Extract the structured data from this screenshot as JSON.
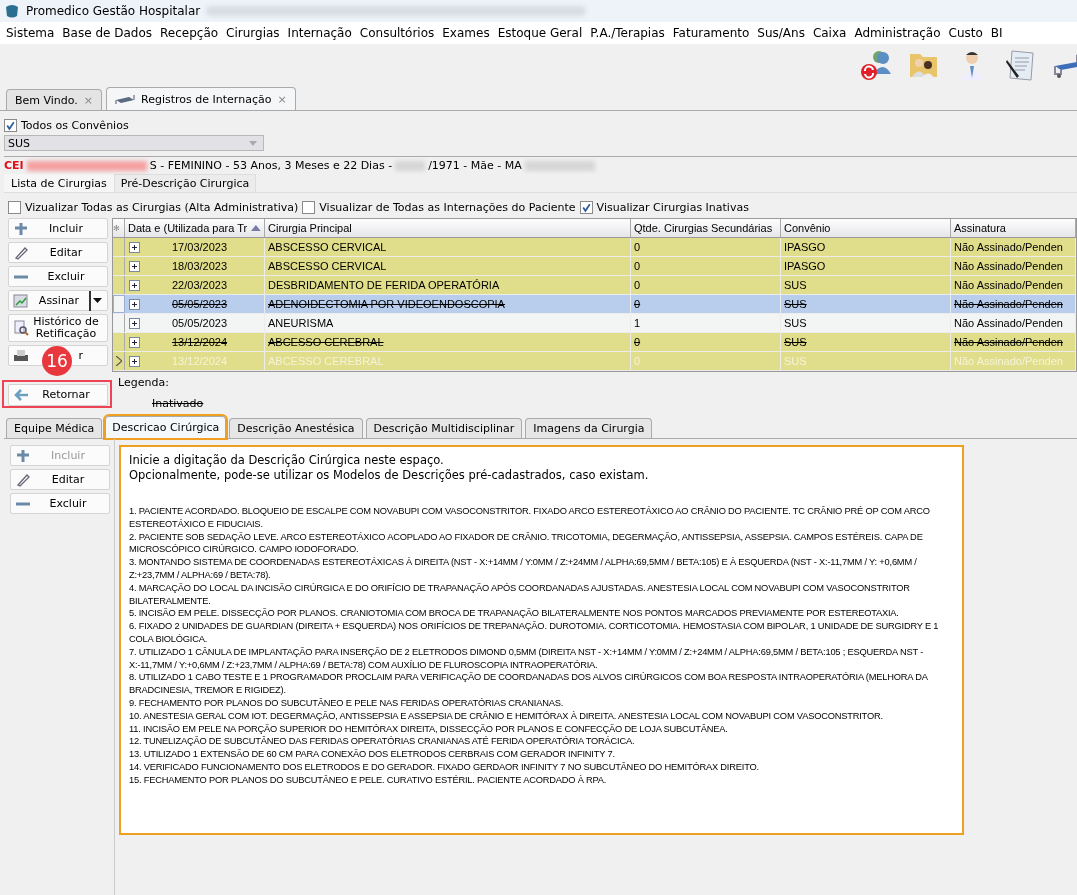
{
  "window": {
    "title": "Promedico Gestão Hospitalar"
  },
  "menu": [
    "Sistema",
    "Base de Dados",
    "Recepção",
    "Cirurgias",
    "Internação",
    "Consultórios",
    "Exames",
    "Estoque Geral",
    "P.A./Terapias",
    "Faturamento",
    "Sus/Ans",
    "Caixa",
    "Administração",
    "Custo",
    "BI"
  ],
  "toolbar": [
    {
      "kind": "users-refresh"
    },
    {
      "kind": "folder-people"
    },
    {
      "kind": "doctor"
    },
    {
      "kind": "document-pen"
    },
    {
      "kind": "bed"
    }
  ],
  "doc_tabs": [
    {
      "label": "Bem Vindo.",
      "close": "×",
      "selected": false,
      "icon": false
    },
    {
      "label": "Registros de Internação",
      "close": "×",
      "selected": true,
      "icon": true
    }
  ],
  "all_insurers": {
    "label": "Todos os Convênios",
    "checked": true
  },
  "insurer_select": {
    "value": "SUS"
  },
  "patient": {
    "name_start": "CEI",
    "info": "S - FEMININO - 53 Anos, 3 Meses e 22 Dias -",
    "birth": "/1971 - Mãe - MA"
  },
  "sub_tabs": [
    {
      "label": "Lista de Cirurgias",
      "selected": true
    },
    {
      "label": "Pré-Descrição Cirurgica",
      "selected": false
    }
  ],
  "filters": [
    {
      "label": "Vizualizar Todas as Cirurgias (Alta Administrativa)",
      "checked": false
    },
    {
      "label": "Visualizar de Todas as Internações do Paciente",
      "checked": false
    },
    {
      "label": "Visualizar Cirurgias Inativas",
      "checked": true
    }
  ],
  "actions": [
    {
      "label": "Incluir",
      "kind": "plus"
    },
    {
      "label": "Editar",
      "kind": "pencil"
    },
    {
      "label": "Excluir",
      "kind": "minus"
    },
    {
      "label": "Assinar",
      "kind": "sign",
      "dropdown": true
    },
    {
      "label": "Histórico de Retificação",
      "kind": "search"
    },
    {
      "label": "r",
      "kind": "printer"
    }
  ],
  "table": {
    "corner": "✻",
    "columns": [
      "Data e (Utilizada para Tr",
      "Cirurgia Principal",
      "Qtde. Cirurgias Secundárias",
      "Convênio",
      "Assinatura"
    ],
    "rows": [
      {
        "cells": [
          "17/03/2023",
          "ABSCESSO CERVICAL",
          "0",
          "IPASGO",
          "Não Assinado/Penden"
        ],
        "color": "#e1de8b",
        "selected": false,
        "inactive": false,
        "faded": false,
        "current": false
      },
      {
        "cells": [
          "18/03/2023",
          "ABSCESSO CERVICAL",
          "0",
          "IPASGO",
          "Não Assinado/Penden"
        ],
        "color": "#e1de8b",
        "selected": false,
        "inactive": false,
        "faded": false,
        "current": false
      },
      {
        "cells": [
          "22/03/2023",
          "DESBRIDAMENTO DE FERIDA OPERATÓRIA",
          "0",
          "SUS",
          "Não Assinado/Penden"
        ],
        "color": "#e1de8b",
        "selected": false,
        "inactive": false,
        "faded": false,
        "current": false
      },
      {
        "cells": [
          "05/05/2023",
          "ADENOIDECTOMIA POR VIDEOENDOSCOPIA",
          "0",
          "SUS",
          "Não Assinado/Penden"
        ],
        "color": "#f3f5f5",
        "selected": true,
        "inactive": true,
        "faded": false,
        "current": false
      },
      {
        "cells": [
          "05/05/2023",
          "ANEURISMA",
          "1",
          "SUS",
          "Não Assinado/Penden"
        ],
        "color": "#f3f5f5",
        "selected": false,
        "inactive": false,
        "faded": false,
        "current": false
      },
      {
        "cells": [
          "13/12/2024",
          "ABCESSO CEREBRAL",
          "0",
          "SUS",
          "Não Assinado/Penden"
        ],
        "color": "#e1de8b",
        "selected": false,
        "inactive": true,
        "faded": false,
        "current": false
      },
      {
        "cells": [
          "13/12/2024",
          "ABCESSO CEREBRAL",
          "0",
          "SUS",
          "Não Assinado/Penden"
        ],
        "color": "#e1de8b",
        "selected": false,
        "inactive": false,
        "faded": true,
        "current": true
      }
    ]
  },
  "legend": {
    "title": "Legenda:",
    "item": "Inativado"
  },
  "return_button": {
    "label": "Retornar"
  },
  "step_badge": "16",
  "detail_tabs": [
    {
      "label": "Equipe Médica",
      "selected": false
    },
    {
      "label": "Descricao Cirúrgica",
      "selected": true
    },
    {
      "label": "Descrição Anestésica",
      "selected": false
    },
    {
      "label": "Descrição Multidisciplinar",
      "selected": false
    },
    {
      "label": "Imagens da Cirurgia",
      "selected": false
    }
  ],
  "detail_actions": [
    {
      "label": "Incluir",
      "kind": "plus",
      "disabled": true
    },
    {
      "label": "Editar",
      "kind": "pencil",
      "disabled": false
    },
    {
      "label": "Excluir",
      "kind": "minus",
      "disabled": false
    }
  ],
  "description": {
    "intro": [
      "Inicie a digitação da Descrição Cirúrgica neste espaço.",
      "Opcionalmente, pode-se utilizar os Modelos de Descrições pré-cadastrados, caso existam."
    ],
    "steps": [
      "1. PACIENTE ACORDADO. BLOQUEIO DE ESCALPE COM NOVABUPI COM VASOCONSTRITOR. FIXADO ARCO ESTEREOTÁXICO AO CRÂNIO DO PACIENTE. TC CRÂNIO PRÉ OP COM ARCO ESTEREOTÁXICO E FIDUCIAIS.",
      "2. PACIENTE SOB SEDAÇÃO LEVE. ARCO ESTEREOTÁXICO ACOPLADO AO FIXADOR DE CRÂNIO. TRICOTOMIA, DEGERMAÇÃO, ANTISSEPSIA, ASSEPSIA. CAMPOS ESTÉREIS. CAPA DE MICROSCÓPICO CIRÚRGICO. CAMPO IODOFORADO.",
      "3. MONTANDO SISTEMA DE COORDENADAS ESTEREOTÁXICAS À DIREITA (NST - X:+14MM / Y:0MM / Z:+24MM / ALPHA:69,5MM / BETA:105) E À ESQUERDA (NST - X:-11,7MM / Y: +0,6MM / Z:+23,7MM / ALPHA:69 / BETA:78).",
      "4. MARCAÇÃO DO LOCAL DA INCISÃO CIRÚRGICA E DO ORIFÍCIO DE TRAPANAÇÃO APÓS COORDANADAS AJUSTADAS. ANESTESIA LOCAL COM NOVABUPI COM VASOCONSTRITOR BILATERALMENTE.",
      "5. INCISÃO EM PELE. DISSECÇÃO POR PLANOS. CRANIOTOMIA COM BROCA DE TRAPANAÇÃO BILATERALMENTE NOS PONTOS MARCADOS PREVIAMENTE POR ESTEREOTAXIA.",
      "6. FIXADO 2 UNIDADES DE GUARDIAN (DIREITA + ESQUERDA) NOS ORIFÍCIOS DE TREPANAÇÃO. DUROTOMIA. CORTICOTOMIA. HEMOSTASIA COM BIPOLAR, 1 UNIDADE DE SURGIDRY E 1 COLA BIOLÓGICA.",
      "7. UTILIZADO 1 CÂNULA DE IMPLANTAÇÃO PARA INSERÇÃO DE 2 ELETRODOS DIMOND 0,5MM (DIREITA NST - X:+14MM / Y:0MM / Z:+24MM / ALPHA:69,5MM / BETA:105 ; ESQUERDA NST - X:-11,7MM / Y:+0,6MM / Z:+23,7MM / ALPHA:69 / BETA:78) COM AUXÍLIO DE FLUROSCOPIA INTRAOPERATÓRIA.",
      "8. UTILIZADO 1 CABO TESTE E 1 PROGRAMADOR PROCLAIM PARA VERIFICAÇÃO DE COORDANADAS DOS ALVOS CIRÚRGICOS COM BOA RESPOSTA INTRAOPERATÓRIA (MELHORA DA BRADCINESIA, TREMOR E RIGIDEZ).",
      "9. FECHAMENTO POR PLANOS DO SUBCUTÂNEO E PELE NAS FERIDAS OPERATÓRIAS CRANIANAS.",
      "10. ANESTESIA GERAL COM IOT. DEGERMAÇÃO, ANTISSEPSIA E ASSEPSIA DE CRÂNIO E HEMITÓRAX À DIREITA. ANESTESIA LOCAL COM NOVABUPI COM VASOCONSTRITOR.",
      "11. INCISÃO EM PELE NA PORÇÃO SUPERIOR DO HEMITÓRAX DIREITA, DISSECÇÃO POR PLANOS E CONFECÇÃO DE LOJA SUBCUTÂNEA.",
      "12. TUNELIZAÇÃO DE SUBCUTÂNEO DAS FERIDAS OPERATÓRIAS CRANIANAS ATÉ FERIDA OPERATÓRIA TORÁCICA.",
      "13. UTILIZADO 1 EXTENSÃO DE 60 CM PARA CONEXÃO DOS ELETRODOS CERBRAIS COM GERADOR INFINITY 7.",
      "14. VERIFICADO FUNCIONAMENTO DOS ELETRODOS E DO GERADOR. FIXADO GERDAOR INFINITY 7 NO SUBCUTÂNEO DO HEMITÓRAX DIREITO.",
      "15. FECHAMENTO POR PLANOS DO SUBCUTÂNEO E PELE. CURATIVO ESTÉRIL. PACIENTE ACORDADO À RPA."
    ]
  }
}
